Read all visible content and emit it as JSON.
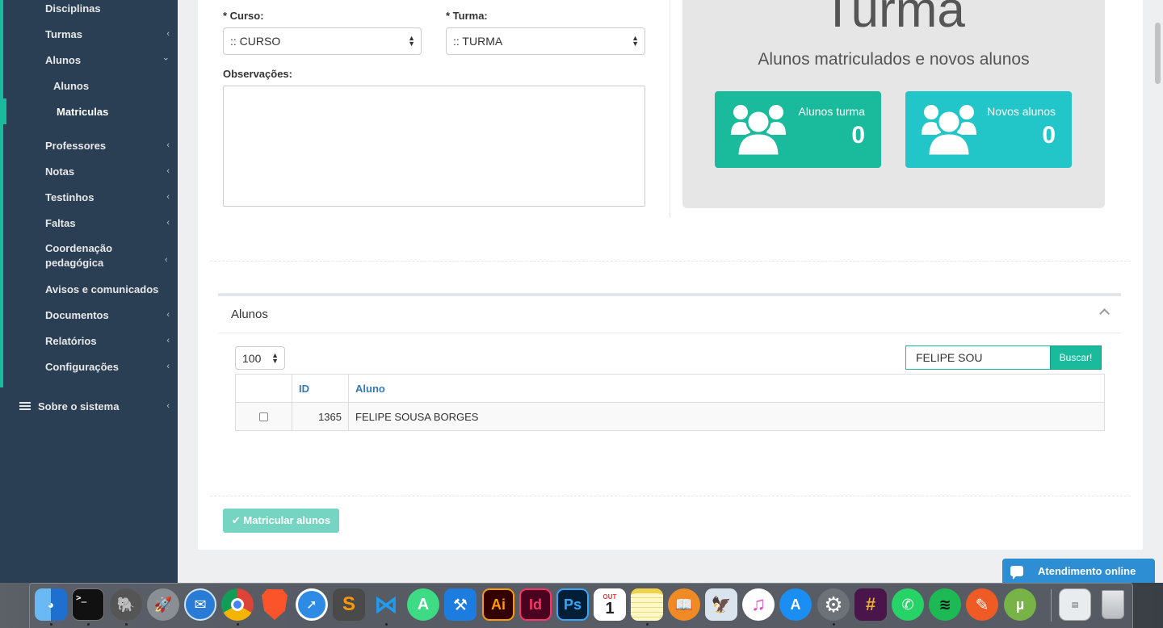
{
  "sidebar": {
    "items": [
      {
        "label": "Disciplinas",
        "chevron": ""
      },
      {
        "label": "Turmas",
        "chevron": "‹"
      },
      {
        "label": "Alunos",
        "chevron": "⌄"
      },
      {
        "label": "Professores",
        "chevron": "‹"
      },
      {
        "label": "Notas",
        "chevron": "‹"
      },
      {
        "label": "Testinhos",
        "chevron": "‹"
      },
      {
        "label": "Faltas",
        "chevron": "‹"
      },
      {
        "label": "Coordenação pedagógica",
        "chevron": "‹"
      },
      {
        "label": "Avisos e comunicados",
        "chevron": ""
      },
      {
        "label": "Documentos",
        "chevron": "‹"
      },
      {
        "label": "Relatórios",
        "chevron": "‹"
      },
      {
        "label": "Configurações",
        "chevron": "‹"
      }
    ],
    "subitems": [
      {
        "label": "Alunos"
      },
      {
        "label": "Matriculas"
      }
    ],
    "about": {
      "label": "Sobre o sistema",
      "chevron": "‹",
      "icon": "list-icon"
    }
  },
  "form": {
    "curso_label": "* Curso:",
    "curso_value": ":: CURSO",
    "turma_label": "* Turma:",
    "turma_value": ":: TURMA",
    "obs_label": "Observações:"
  },
  "turma_panel": {
    "title": "Turma",
    "subtitle": "Alunos matriculados e novos alunos",
    "tiles": [
      {
        "label": "Alunos turma",
        "value": "0",
        "color": "#1abb9c",
        "icon": "users-icon"
      },
      {
        "label": "Novos alunos",
        "value": "0",
        "color": "#23c6c8",
        "icon": "users-icon"
      }
    ]
  },
  "alunos": {
    "title": "Alunos",
    "page_size": "100",
    "search_value": "FELIPE SOU",
    "search_button": "Buscar!",
    "columns": [
      "",
      "ID",
      "Aluno"
    ],
    "rows": [
      {
        "id": "1365",
        "name": "FELIPE SOUSA BORGES"
      }
    ]
  },
  "actions": {
    "matricular": "✔ Matricular alunos"
  },
  "chat": {
    "label": "Atendimento online"
  },
  "dock": {
    "calendar_month": "OUT",
    "calendar_day": "1",
    "apps": [
      "finder",
      "terminal",
      "sequel-pro",
      "launchpad",
      "mail-alt",
      "chrome",
      "brave",
      "safari",
      "sublime-text",
      "vscode",
      "android-studio",
      "xcode",
      "illustrator",
      "indesign",
      "photoshop",
      "calendar",
      "notes",
      "ibooks",
      "preview",
      "itunes",
      "app-store",
      "system-preferences",
      "slack",
      "whatsapp",
      "spotify",
      "postman",
      "utorrent",
      "documents",
      "trash"
    ]
  },
  "colors": {
    "sidebar_bg": "#2a3f54",
    "accent": "#1abb9c",
    "tile2": "#23c6c8",
    "chat": "#2d8ed3"
  }
}
